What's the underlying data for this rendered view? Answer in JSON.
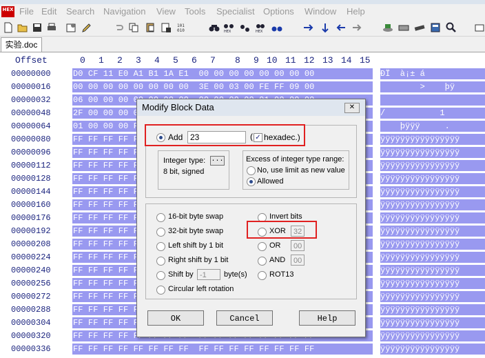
{
  "menu": {
    "items": [
      "File",
      "Edit",
      "Search",
      "Navigation",
      "View",
      "Tools",
      "Specialist",
      "Options",
      "Window",
      "Help"
    ],
    "logo": "HEX"
  },
  "tab": {
    "label": "实验.doc"
  },
  "hex": {
    "offset_header": "Offset",
    "columns": [
      "0",
      "1",
      "2",
      "3",
      "4",
      "5",
      "6",
      "7",
      "8",
      "9",
      "10",
      "11",
      "12",
      "13",
      "14",
      "15"
    ],
    "offsets": [
      "00000000",
      "00000016",
      "00000032",
      "00000048",
      "00000064",
      "00000080",
      "00000096",
      "00000112",
      "00000128",
      "00000144",
      "00000160",
      "00000176",
      "00000192",
      "00000208",
      "00000224",
      "00000240",
      "00000256",
      "00000272",
      "00000288",
      "00000304",
      "00000320",
      "00000336"
    ],
    "rows": [
      "D0 CF 11 E0 A1 B1 1A E1  00 00 00 00 00 00 00 00",
      "00 00 00 00 00 00 00 00  3E 00 03 00 FE FF 09 00",
      "06 00 00 00 00 00 00 00  00 00 00 00 01 00 00 00",
      "2F 00 00 00 00 00 00 00  00 10 00 00 31 00 00 00",
      "01 00 00 00 FE FF FF FF  00 00 00 00 2E 00 00 00",
      "FF FF FF FF FF FF FF FF  FF FF FF FF FF FF FF FF",
      "FF FF FF FF FF FF FF FF  FF FF FF FF FF FF FF FF",
      "FF FF FF FF FF FF FF FF  FF FF FF FF FF FF FF FF",
      "FF FF FF FF FF FF FF FF  FF FF FF FF FF FF FF FF",
      "FF FF FF FF FF FF FF FF  FF FF FF FF FF FF FF FF",
      "FF FF FF FF FF FF FF FF  FF FF FF FF FF FF FF FF",
      "FF FF FF FF FF FF FF FF  FF FF FF FF FF FF FF FF",
      "FF FF FF FF FF FF FF FF  FF FF FF FF FF FF FF FF",
      "FF FF FF FF FF FF FF FF  FF FF FF FF FF FF FF FF",
      "FF FF FF FF FF FF FF FF  FF FF FF FF FF FF FF FF",
      "FF FF FF FF FF FF FF FF  FF FF FF FF FF FF FF FF",
      "FF FF FF FF FF FF FF FF  FF FF FF FF FF FF FF FF",
      "FF FF FF FF FF FF FF FF  FF FF FF FF FF FF FF FF",
      "FF FF FF FF FF FF FF FF  FF FF FF FF FF FF FF FF",
      "FF FF FF FF FF FF FF FF  FF FF FF FF FF FF FF FF",
      "FF FF FF FF FF FF FF FF  FF FF FF FF FF FF FF FF",
      "FF FF FF FF FF FF FF FF  FF FF FF FF FF FF FF FF"
    ],
    "text": [
      "ÐÏ  à¡± á",
      "        >    þÿ",
      "",
      "/           1",
      "    þÿÿÿ     .",
      "ÿÿÿÿÿÿÿÿÿÿÿÿÿÿÿÿ",
      "ÿÿÿÿÿÿÿÿÿÿÿÿÿÿÿÿ",
      "ÿÿÿÿÿÿÿÿÿÿÿÿÿÿÿÿ",
      "ÿÿÿÿÿÿÿÿÿÿÿÿÿÿÿÿ",
      "ÿÿÿÿÿÿÿÿÿÿÿÿÿÿÿÿ",
      "ÿÿÿÿÿÿÿÿÿÿÿÿÿÿÿÿ",
      "ÿÿÿÿÿÿÿÿÿÿÿÿÿÿÿÿ",
      "ÿÿÿÿÿÿÿÿÿÿÿÿÿÿÿÿ",
      "ÿÿÿÿÿÿÿÿÿÿÿÿÿÿÿÿ",
      "ÿÿÿÿÿÿÿÿÿÿÿÿÿÿÿÿ",
      "ÿÿÿÿÿÿÿÿÿÿÿÿÿÿÿÿ",
      "ÿÿÿÿÿÿÿÿÿÿÿÿÿÿÿÿ",
      "ÿÿÿÿÿÿÿÿÿÿÿÿÿÿÿÿ",
      "ÿÿÿÿÿÿÿÿÿÿÿÿÿÿÿÿ",
      "ÿÿÿÿÿÿÿÿÿÿÿÿÿÿÿÿ",
      "ÿÿÿÿÿÿÿÿÿÿÿÿÿÿÿÿ",
      "ÿÿÿÿÿÿÿÿÿÿÿÿÿÿÿÿ"
    ]
  },
  "dialog": {
    "title": "Modify Block Data",
    "close": "✕",
    "add_label": "Add",
    "add_value": "23",
    "hexadec_label": "hexadec.)",
    "paren_open": "(",
    "integer_type_label": "Integer type:",
    "integer_type_value": "8 bit, signed",
    "integer_type_button": "...",
    "excess_label": "Excess of integer type range:",
    "excess_option1": "No, use limit as new value",
    "excess_option2": "Allowed",
    "ops_left": [
      "16-bit byte swap",
      "32-bit byte swap",
      "Left shift by 1 bit",
      "Right shift by 1 bit",
      "Shift by",
      "Circular left rotation"
    ],
    "shift_value": "-1",
    "shift_unit": "byte(s)",
    "ops_right": [
      "Invert bits",
      "XOR",
      "OR",
      "AND",
      "ROT13"
    ],
    "xor_value": "32",
    "or_value": "00",
    "and_value": "00",
    "ok": "OK",
    "cancel": "Cancel",
    "help": "Help"
  },
  "colors": {
    "selection": "#9999f0",
    "highlight": "#e02020",
    "offset_text": "#1a237e"
  }
}
